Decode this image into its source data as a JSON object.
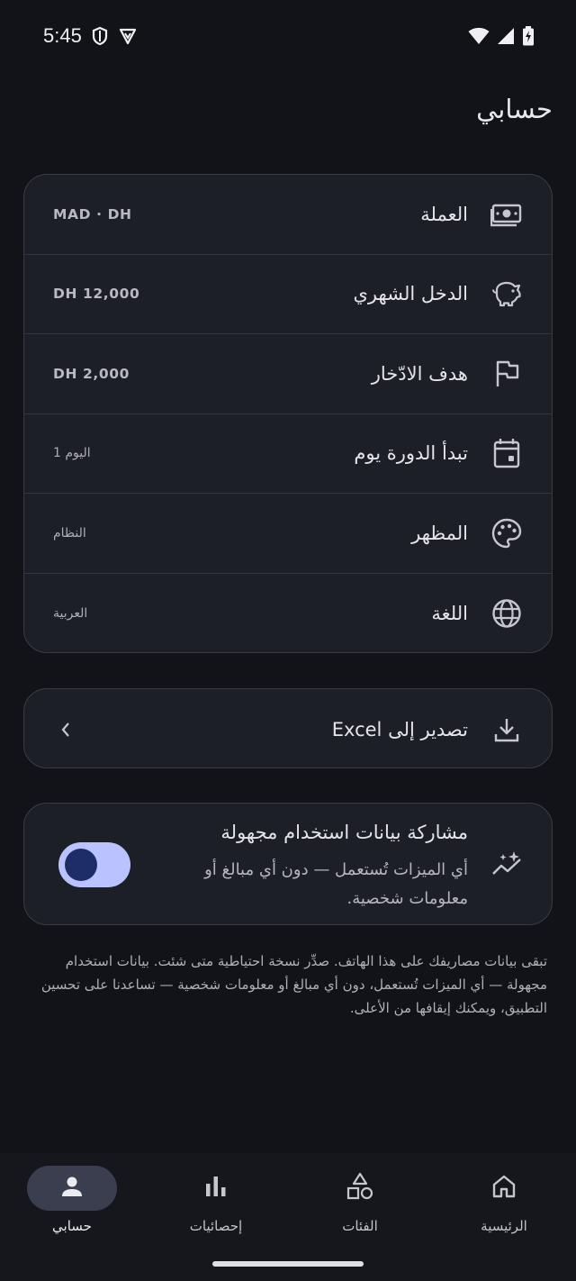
{
  "status": {
    "time": "5:45"
  },
  "page": {
    "title": "حسابي"
  },
  "settings": [
    {
      "label": "العملة",
      "value": "MAD · DH",
      "icon": "banknote-icon"
    },
    {
      "label": "الدخل الشهري",
      "value": "DH 12,000",
      "icon": "piggy-bank-icon"
    },
    {
      "label": "هدف الادّخار",
      "value": "DH 2,000",
      "icon": "flag-icon"
    },
    {
      "label": "تبدأ الدورة يوم",
      "value": "اليوم 1",
      "icon": "calendar-icon"
    },
    {
      "label": "المظهر",
      "value": "النظام",
      "icon": "palette-icon"
    },
    {
      "label": "اللغة",
      "value": "العربية",
      "icon": "globe-icon"
    }
  ],
  "export": {
    "label": "تصدير إلى Excel"
  },
  "share": {
    "title": "مشاركة بيانات استخدام مجهولة",
    "description": "أي الميزات تُستعمل — دون أي مبالغ أو معلومات شخصية.",
    "enabled": true
  },
  "note": "تبقى بيانات مصاريفك على هذا الهاتف. صدِّر نسخة احتياطية متى شئت. بيانات استخدام مجهولة — أي الميزات تُستعمل، دون أي مبالغ أو معلومات شخصية — تساعدنا على تحسين التطبيق، ويمكنك إيقافها من الأعلى.",
  "nav": [
    {
      "label": "حسابي",
      "icon": "person-icon",
      "active": true
    },
    {
      "label": "إحصائيات",
      "icon": "bar-chart-icon",
      "active": false
    },
    {
      "label": "الفئات",
      "icon": "shapes-icon",
      "active": false
    },
    {
      "label": "الرئيسية",
      "icon": "home-icon",
      "active": false
    }
  ],
  "colors": {
    "accent": "#bac3ff",
    "background": "#121318",
    "card": "#1d1f26"
  }
}
